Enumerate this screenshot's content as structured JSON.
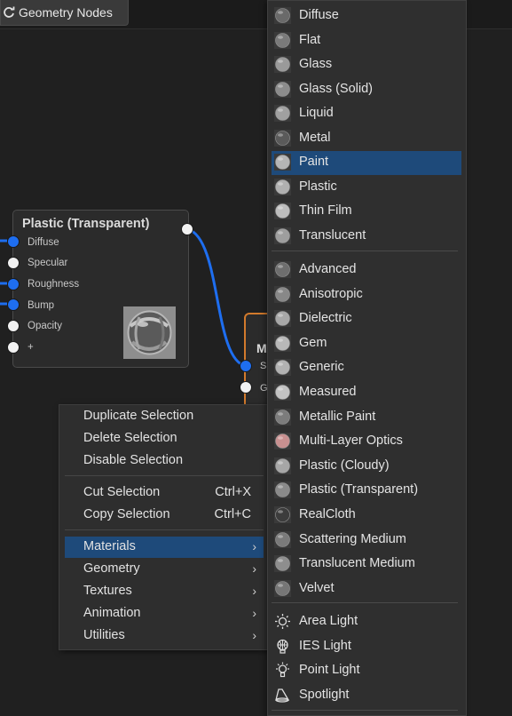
{
  "tab": {
    "label": "Geometry Nodes"
  },
  "node": {
    "title": "Plastic (Transparent)",
    "ports": [
      {
        "label": "Diffuse",
        "style": "blue"
      },
      {
        "label": "Specular",
        "style": "white"
      },
      {
        "label": "Roughness",
        "style": "blue"
      },
      {
        "label": "Bump",
        "style": "blue"
      },
      {
        "label": "Opacity",
        "style": "white"
      },
      {
        "label": "+",
        "style": "white"
      }
    ]
  },
  "node2": {
    "title": "M",
    "ports": [
      "S",
      "G"
    ]
  },
  "context_menu": {
    "groups": [
      [
        {
          "label": "Duplicate Selection"
        },
        {
          "label": "Delete Selection"
        },
        {
          "label": "Disable Selection"
        }
      ],
      [
        {
          "label": "Cut Selection",
          "shortcut": "Ctrl+X"
        },
        {
          "label": "Copy Selection",
          "shortcut": "Ctrl+C"
        }
      ],
      [
        {
          "label": "Materials",
          "submenu": true,
          "active": true
        },
        {
          "label": "Geometry",
          "submenu": true
        },
        {
          "label": "Textures",
          "submenu": true
        },
        {
          "label": "Animation",
          "submenu": true
        },
        {
          "label": "Utilities",
          "submenu": true
        }
      ]
    ]
  },
  "materials_menu": {
    "groups": [
      [
        {
          "label": "Diffuse",
          "icon": "diffuse-sphere-icon",
          "color": "#6a6a6a"
        },
        {
          "label": "Flat",
          "icon": "flat-sphere-icon",
          "color": "#7a7a7a"
        },
        {
          "label": "Glass",
          "icon": "glass-sphere-icon",
          "color": "#9a9a9a"
        },
        {
          "label": "Glass (Solid)",
          "icon": "glass-solid-sphere-icon",
          "color": "#8c8c8c"
        },
        {
          "label": "Liquid",
          "icon": "liquid-sphere-icon",
          "color": "#a0a0a0"
        },
        {
          "label": "Metal",
          "icon": "metal-sphere-icon",
          "color": "#5a5a5a"
        },
        {
          "label": "Paint",
          "icon": "paint-sphere-icon",
          "color": "#b5b5b5",
          "active": true
        },
        {
          "label": "Plastic",
          "icon": "plastic-sphere-icon",
          "color": "#b0b0b0"
        },
        {
          "label": "Thin Film",
          "icon": "thin-film-sphere-icon",
          "color": "#bdbdbd"
        },
        {
          "label": "Translucent",
          "icon": "translucent-sphere-icon",
          "color": "#9e9e9e"
        }
      ],
      [
        {
          "label": "Advanced",
          "icon": "advanced-sphere-icon",
          "color": "#6e6e6e"
        },
        {
          "label": "Anisotropic",
          "icon": "anisotropic-sphere-icon",
          "color": "#888888"
        },
        {
          "label": "Dielectric",
          "icon": "dielectric-sphere-icon",
          "color": "#a8a8a8"
        },
        {
          "label": "Gem",
          "icon": "gem-sphere-icon",
          "color": "#b8b8b8"
        },
        {
          "label": "Generic",
          "icon": "generic-sphere-icon",
          "color": "#b2b2b2"
        },
        {
          "label": "Measured",
          "icon": "measured-sphere-icon",
          "color": "#c2c2c2"
        },
        {
          "label": "Metallic Paint",
          "icon": "metallic-paint-sphere-icon",
          "color": "#7c7c7c"
        },
        {
          "label": "Multi-Layer Optics",
          "icon": "multi-layer-optics-sphere-icon",
          "color": "#c89090"
        },
        {
          "label": "Plastic (Cloudy)",
          "icon": "plastic-cloudy-sphere-icon",
          "color": "#a6a6a6"
        },
        {
          "label": "Plastic (Transparent)",
          "icon": "plastic-transparent-sphere-icon",
          "color": "#8a8a8a"
        },
        {
          "label": "RealCloth",
          "icon": "realcloth-sphere-icon",
          "color": "#3c3c3c"
        },
        {
          "label": "Scattering Medium",
          "icon": "scattering-medium-sphere-icon",
          "color": "#7a7a7a"
        },
        {
          "label": "Translucent Medium",
          "icon": "translucent-medium-sphere-icon",
          "color": "#8e8e8e"
        },
        {
          "label": "Velvet",
          "icon": "velvet-sphere-icon",
          "color": "#767676"
        }
      ],
      [
        {
          "label": "Area Light",
          "icon": "area-light-icon"
        },
        {
          "label": "IES Light",
          "icon": "ies-light-icon"
        },
        {
          "label": "Point Light",
          "icon": "point-light-icon"
        },
        {
          "label": "Spotlight",
          "icon": "spotlight-icon"
        }
      ]
    ]
  },
  "colors": {
    "accent": "#1e4a7a",
    "wire": "#1e6ef0",
    "node_border_orange": "#d27a2c"
  }
}
